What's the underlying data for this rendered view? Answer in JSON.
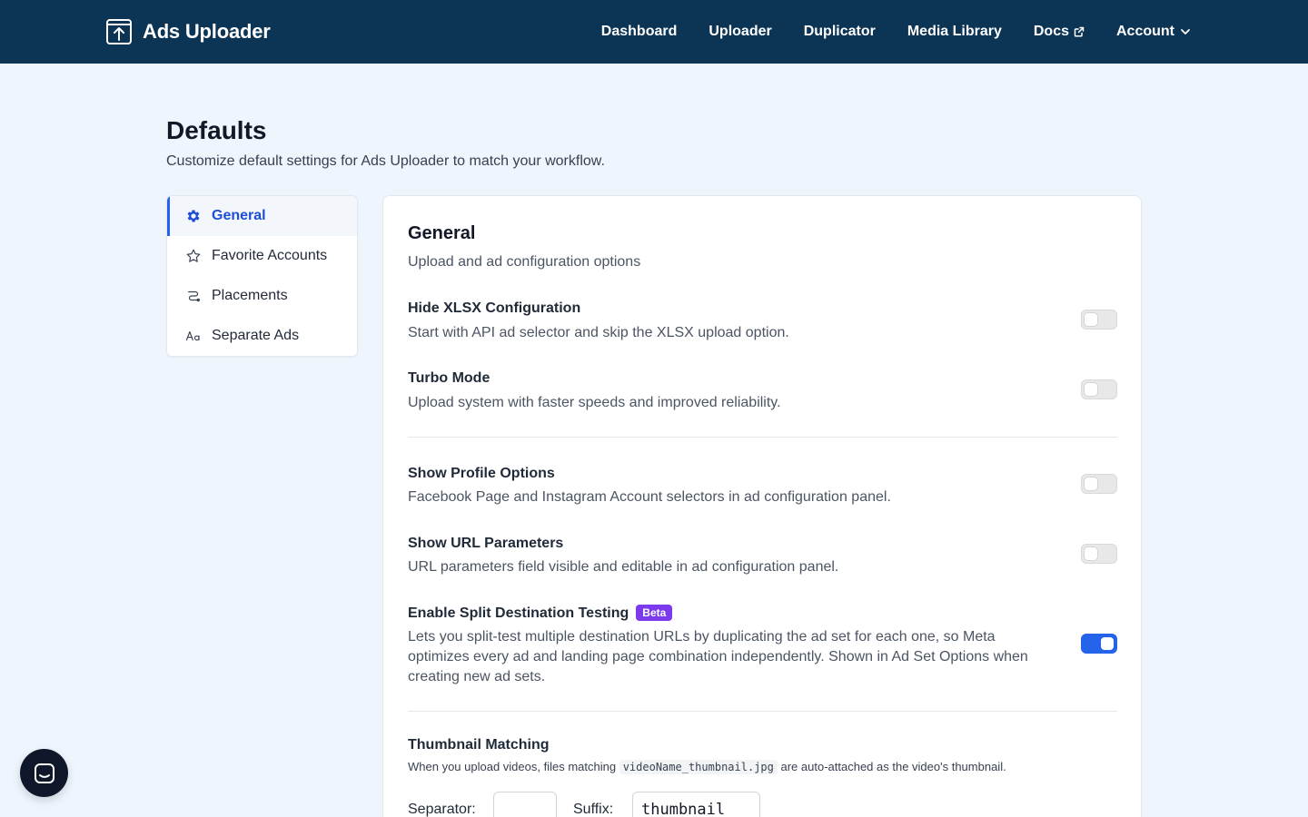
{
  "app": {
    "name": "Ads Uploader"
  },
  "nav": {
    "items": [
      {
        "label": "Dashboard"
      },
      {
        "label": "Uploader"
      },
      {
        "label": "Duplicator"
      },
      {
        "label": "Media Library"
      },
      {
        "label": "Docs"
      },
      {
        "label": "Account"
      }
    ]
  },
  "page": {
    "title": "Defaults",
    "subtitle": "Customize default settings for Ads Uploader to match your workflow."
  },
  "sidebar": {
    "items": [
      {
        "label": "General",
        "icon": "gear-icon",
        "active": true
      },
      {
        "label": "Favorite Accounts",
        "icon": "star-icon",
        "active": false
      },
      {
        "label": "Placements",
        "icon": "route-icon",
        "active": false
      },
      {
        "label": "Separate Ads",
        "icon": "text-case-icon",
        "active": false
      }
    ]
  },
  "general": {
    "title": "General",
    "description": "Upload and ad configuration options",
    "options": [
      {
        "title": "Hide XLSX Configuration",
        "description": "Start with API ad selector and skip the XLSX upload option.",
        "enabled": false
      },
      {
        "title": "Turbo Mode",
        "description": "Upload system with faster speeds and improved reliability.",
        "enabled": false
      },
      {
        "title": "Show Profile Options",
        "description": "Facebook Page and Instagram Account selectors in ad configuration panel.",
        "enabled": false
      },
      {
        "title": "Show URL Parameters",
        "description": "URL parameters field visible and editable in ad configuration panel.",
        "enabled": false
      },
      {
        "title": "Enable Split Destination Testing",
        "badge": "Beta",
        "description": "Lets you split-test multiple destination URLs by duplicating the ad set for each one, so Meta optimizes every ad and landing page combination independently. Shown in Ad Set Options when creating new ad sets.",
        "enabled": true
      }
    ]
  },
  "thumbnail": {
    "title": "Thumbnail Matching",
    "desc_before": "When you upload videos, files matching",
    "desc_code": "videoName_thumbnail.jpg",
    "desc_after": "are auto-attached as the video's thumbnail.",
    "separator_label": "Separator:",
    "separator_value": "",
    "suffix_label": "Suffix:",
    "suffix_value": "thumbnail"
  },
  "colors": {
    "header_bg": "#0c3455",
    "accent": "#2563eb",
    "badge": "#7c3aed",
    "page_bg": "#eef5fd"
  }
}
